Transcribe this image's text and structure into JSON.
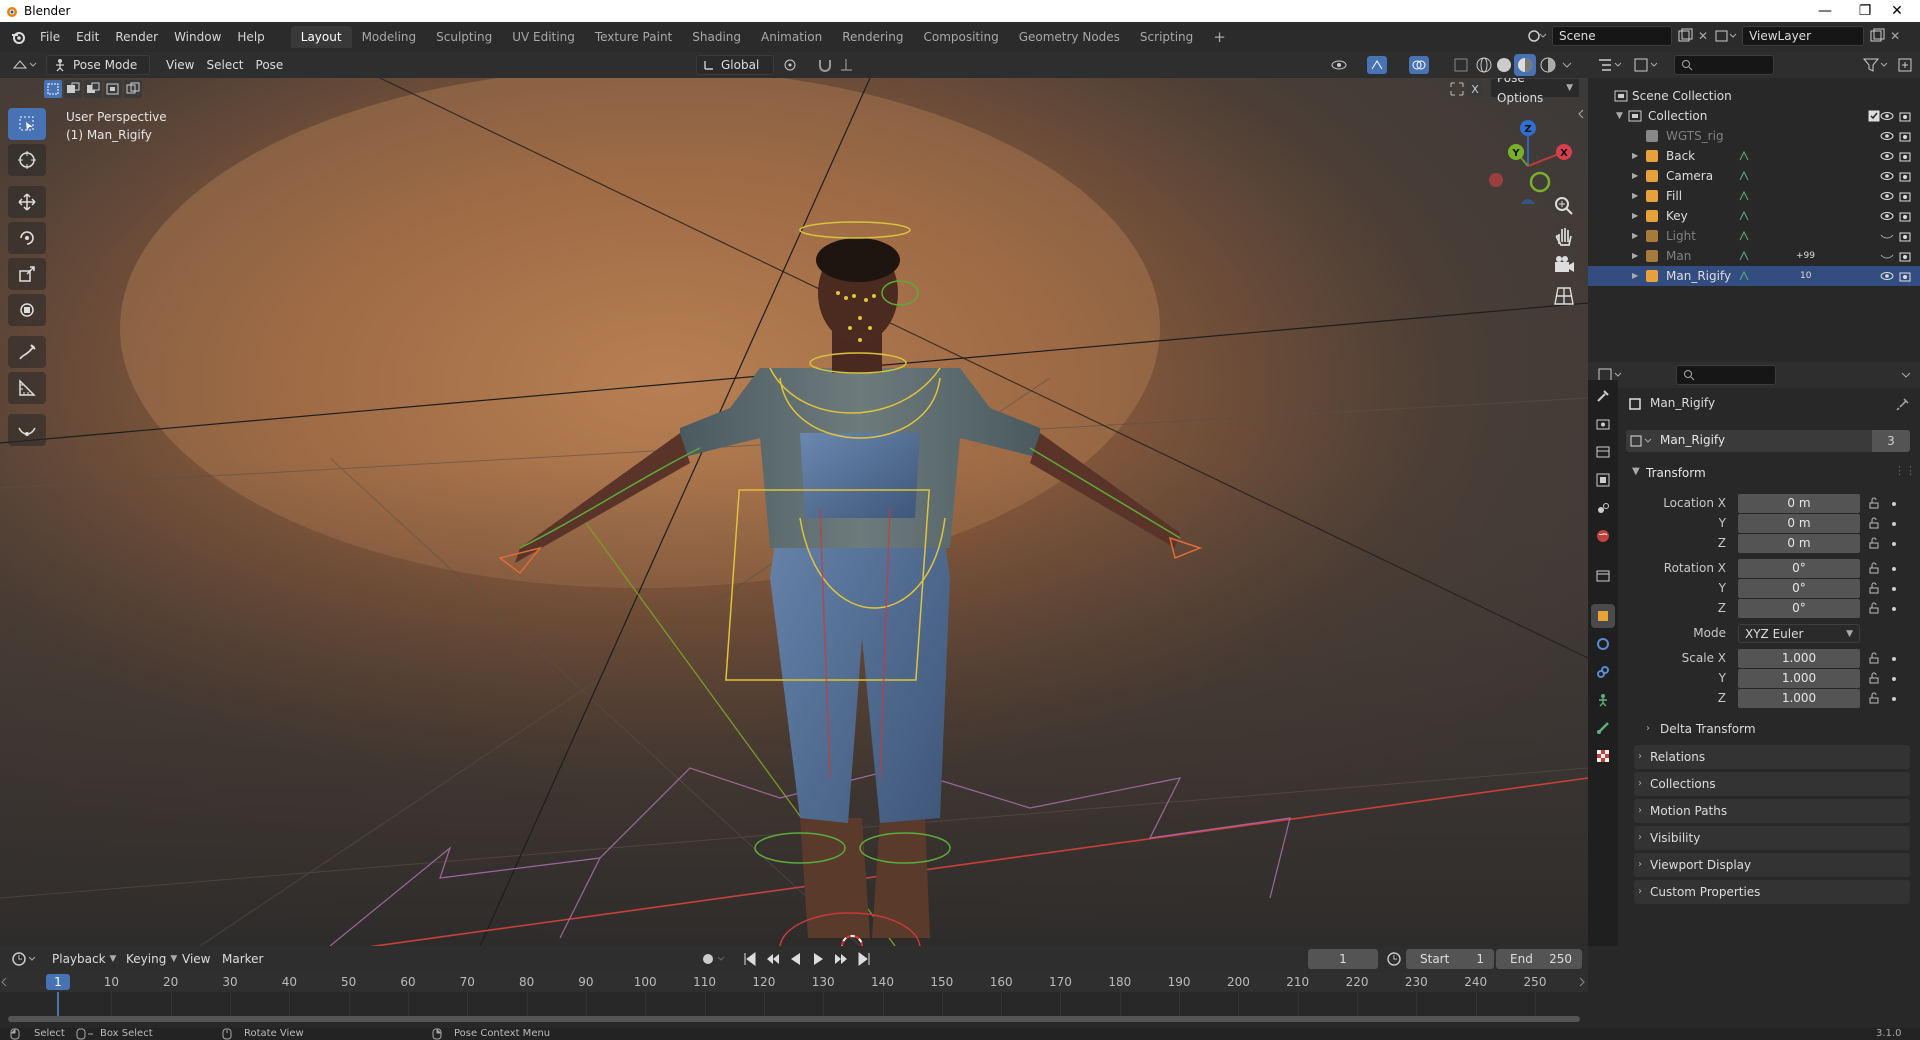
{
  "app_title": "Blender",
  "menus": [
    "File",
    "Edit",
    "Render",
    "Window",
    "Help"
  ],
  "workspaces": [
    "Layout",
    "Modeling",
    "Sculpting",
    "UV Editing",
    "Texture Paint",
    "Shading",
    "Animation",
    "Rendering",
    "Compositing",
    "Geometry Nodes",
    "Scripting"
  ],
  "active_workspace": "Layout",
  "scene_name": "Scene",
  "view_layer": "ViewLayer",
  "viewport_header": {
    "mode": "Pose Mode",
    "menus": [
      "View",
      "Select",
      "Pose"
    ],
    "orientation": "Global",
    "pose_options": "Pose Options"
  },
  "viewport_overlay": {
    "view_name": "User Perspective",
    "object_name": "(1) Man_Rigify"
  },
  "gizmo_axes": {
    "x": "X",
    "y": "Y",
    "z": "Z"
  },
  "outliner": {
    "scene_collection": "Scene Collection",
    "collection": "Collection",
    "items": [
      {
        "name": "WGTS_rig",
        "dim": true
      },
      {
        "name": "Back",
        "dim": false
      },
      {
        "name": "Camera",
        "dim": false
      },
      {
        "name": "Fill",
        "dim": false
      },
      {
        "name": "Key",
        "dim": false
      },
      {
        "name": "Light",
        "dim": true
      },
      {
        "name": "Man",
        "dim": true,
        "badge": "+99"
      },
      {
        "name": "Man_Rigify",
        "dim": false,
        "selected": true,
        "badge": "10"
      }
    ]
  },
  "properties": {
    "object_name": "Man_Rigify",
    "data_name": "Man_Rigify",
    "user_count": "3",
    "transform_label": "Transform",
    "location_label": "Location X",
    "rotation_label": "Rotation X",
    "scale_label": "Scale X",
    "axis_y": "Y",
    "axis_z": "Z",
    "location": [
      "0 m",
      "0 m",
      "0 m"
    ],
    "rotation": [
      "0°",
      "0°",
      "0°"
    ],
    "mode_label": "Mode",
    "mode_value": "XYZ Euler",
    "scale": [
      "1.000",
      "1.000",
      "1.000"
    ],
    "delta_transform": "Delta Transform",
    "panels": [
      "Relations",
      "Collections",
      "Motion Paths",
      "Visibility",
      "Viewport Display",
      "Custom Properties"
    ]
  },
  "timeline": {
    "menus": [
      "Playback",
      "Keying",
      "View",
      "Marker"
    ],
    "current_frame": "1",
    "start_label": "Start",
    "start": "1",
    "end_label": "End",
    "end": "250",
    "ticks": [
      "1",
      "10",
      "20",
      "30",
      "40",
      "50",
      "60",
      "70",
      "80",
      "90",
      "100",
      "110",
      "120",
      "130",
      "140",
      "150",
      "160",
      "170",
      "180",
      "190",
      "200",
      "210",
      "220",
      "230",
      "240",
      "250"
    ]
  },
  "statusbar": {
    "select": "Select",
    "box_select": "Box Select",
    "rotate_view": "Rotate View",
    "context_menu": "Pose Context Menu",
    "version": "3.1.0"
  }
}
